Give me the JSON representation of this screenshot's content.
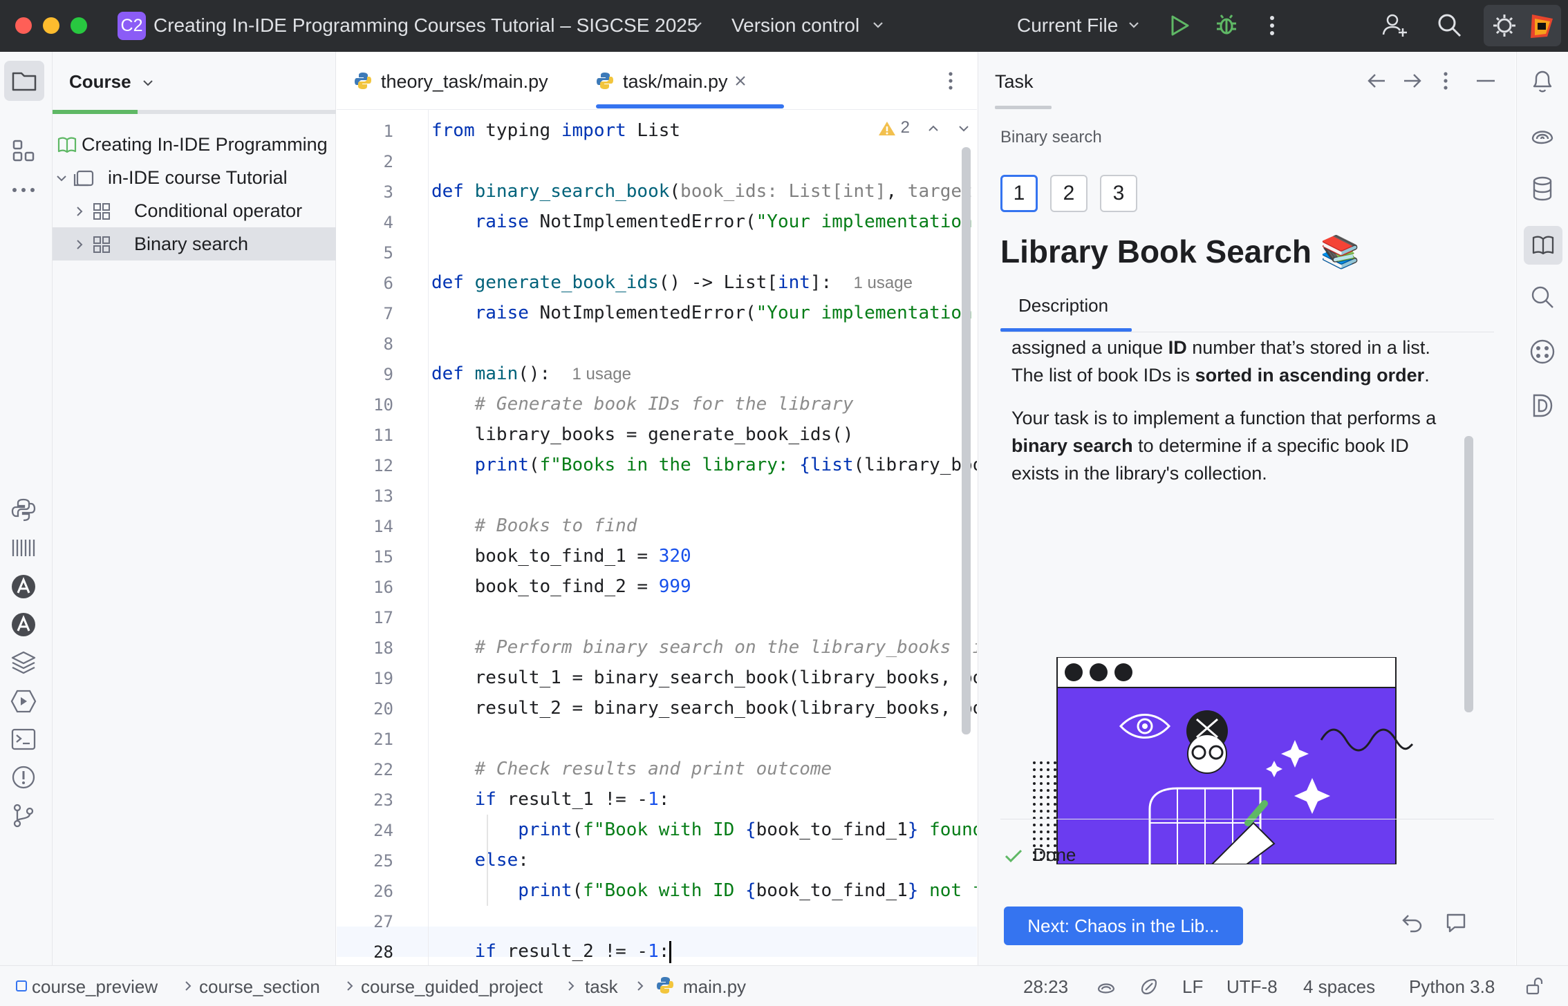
{
  "titlebar": {
    "project_badge": "C2",
    "project_name": "Creating In-IDE Programming Courses Tutorial – SIGCSE 2025",
    "vcs": "Version control",
    "run_config": "Current File"
  },
  "project_panel": {
    "header": "Course",
    "progress_fraction": 0.3,
    "tree": [
      {
        "label": "Creating In-IDE Programming",
        "level": 0
      },
      {
        "label": "in-IDE course Tutorial",
        "level": 1
      },
      {
        "label": "Conditional operator",
        "level": 2
      },
      {
        "label": "Binary search",
        "level": 2,
        "selected": true
      }
    ]
  },
  "editor": {
    "tabs": [
      {
        "label": "theory_task/main.py",
        "active": false
      },
      {
        "label": "task/main.py",
        "active": true
      }
    ],
    "warnings_count": "2",
    "line_numbers": [
      "1",
      "2",
      "3",
      "4",
      "5",
      "6",
      "7",
      "8",
      "9",
      "10",
      "11",
      "12",
      "13",
      "14",
      "15",
      "16",
      "17",
      "18",
      "19",
      "20",
      "21",
      "22",
      "23",
      "24",
      "25",
      "26",
      "27",
      "28"
    ],
    "usage_hint": "1 usage"
  },
  "task_panel": {
    "title": "Task",
    "breadcrumb": "Binary search",
    "steps": [
      "1",
      "2",
      "3"
    ],
    "active_step": "1",
    "lesson_title": "Library Book Search 📚",
    "desc_tab": "Description",
    "para1_a": "assigned a unique ",
    "para1_b": "ID",
    "para1_c": " number that’s stored in a list. The list of book IDs is ",
    "para1_d": "sorted in ascending order",
    "para1_e": ".",
    "para2_a": "Your task is to implement a function that performs a ",
    "para2_b": "binary search",
    "para2_c": " to determine if a specific book ID exists in the library's collection.",
    "done_label": "Done",
    "next_button": "Next: Chaos in the Lib..."
  },
  "statusbar": {
    "breadcrumbs": [
      "course_preview",
      "course_section",
      "course_guided_project",
      "task",
      "main.py"
    ],
    "position": "28:23",
    "line_sep": "LF",
    "encoding": "UTF-8",
    "indent": "4 spaces",
    "interpreter": "Python 3.8"
  },
  "colors": {
    "accent": "#3574f0",
    "progress": "#5fb865",
    "titlebar_bg": "#2b2d30",
    "badge": "#8b5cf6",
    "illustration": "#6b3cf0"
  }
}
